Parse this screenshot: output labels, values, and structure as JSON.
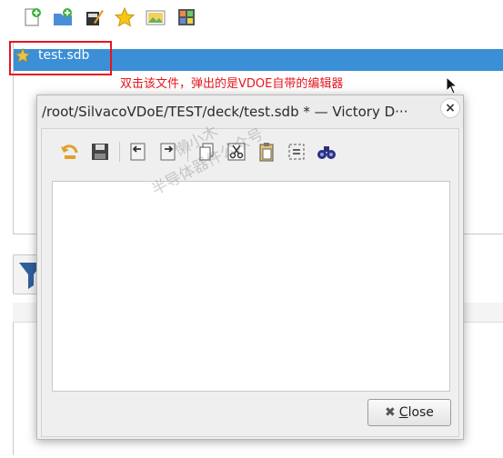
{
  "toolbar": {
    "icons": [
      "new-file-icon",
      "new-folder-icon",
      "edit-icon",
      "favorite-star-icon",
      "image-icon",
      "layout-icon"
    ]
  },
  "file_list": {
    "selected_file": "test.sdb",
    "selected_icon": "star-icon",
    "selection_color": "#3a8fd6"
  },
  "annotation": {
    "text": "双击该文件，弹出的是VDOE自带的编辑器",
    "color": "#e4161f"
  },
  "dialog": {
    "title": "/root/SilvacoVDoE/TEST/deck/test.sdb * — Victory D···",
    "close_x": "×",
    "toolbar_icons": [
      "undo-icon",
      "save-icon",
      "unindent-icon",
      "indent-icon",
      "copy-icon",
      "cut-icon",
      "paste-icon",
      "select-all-icon",
      "find-icon"
    ],
    "editor_content": "",
    "close_button": {
      "prefix": "C",
      "rest": "lose",
      "icon": "close-x-icon"
    }
  },
  "watermark": {
    "line1": "懒小木",
    "line2": "半导体器件公众号"
  }
}
